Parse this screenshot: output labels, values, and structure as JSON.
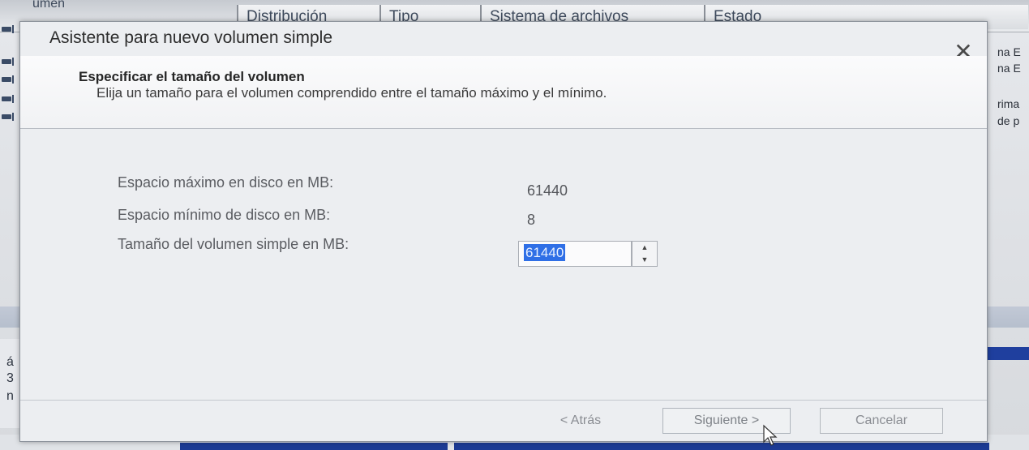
{
  "background": {
    "partial_header": "umen",
    "columns": [
      "Distribución",
      "Tipo",
      "Sistema de archivos",
      "Estado"
    ],
    "right_texts": [
      "na E",
      "na E",
      "rima",
      "de p"
    ],
    "lower_left_texts": [
      "á",
      "3",
      "n"
    ]
  },
  "dialog": {
    "title": "Asistente para nuevo volumen simple",
    "close_glyph": "✕",
    "header": {
      "title": "Especificar el tamaño del volumen",
      "subtitle": "Elija un tamaño para el volumen comprendido entre el tamaño máximo y el mínimo."
    },
    "fields": {
      "max_label": "Espacio máximo en disco en MB:",
      "max_value": "61440",
      "min_label": "Espacio mínimo de disco en MB:",
      "min_value": "8",
      "size_label": "Tamaño del volumen simple en MB:",
      "size_value": "61440"
    },
    "buttons": {
      "back": "< Atrás",
      "next": "Siguiente >",
      "cancel": "Cancelar"
    }
  },
  "colors": {
    "selection": "#2f6fe6",
    "taskbar_blue": "#1c3b94"
  }
}
